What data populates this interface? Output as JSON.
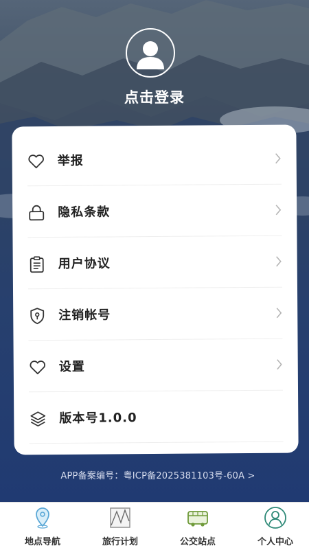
{
  "header": {
    "login_label": "点击登录"
  },
  "menu": [
    {
      "label": "举报",
      "icon": "heart-icon",
      "chevron": true
    },
    {
      "label": "隐私条款",
      "icon": "lock-icon",
      "chevron": true
    },
    {
      "label": "用户协议",
      "icon": "clipboard-icon",
      "chevron": true
    },
    {
      "label": "注销帐号",
      "icon": "shield-icon",
      "chevron": true
    },
    {
      "label": "设置",
      "icon": "heart-icon",
      "chevron": true
    },
    {
      "label": "版本号1.0.0",
      "icon": "layers-icon",
      "chevron": false
    }
  ],
  "footer": {
    "icp_text": "APP备案编号：粤ICP备2025381103号-60A >"
  },
  "tabbar": [
    {
      "label": "地点导航",
      "icon": "location-pin-icon",
      "active": false
    },
    {
      "label": "旅行计划",
      "icon": "map-icon",
      "active": false
    },
    {
      "label": "公交站点",
      "icon": "bus-icon",
      "active": false
    },
    {
      "label": "个人中心",
      "icon": "user-circle-icon",
      "active": true
    }
  ],
  "colors": {
    "card_bg": "#ffffff",
    "page_bg": "#1e3566",
    "tab_icon_blue": "#5aa7d6",
    "tab_icon_green": "#6f9a3a",
    "tab_icon_teal": "#2f8a78",
    "tab_icon_gray": "#8a8a8a"
  }
}
